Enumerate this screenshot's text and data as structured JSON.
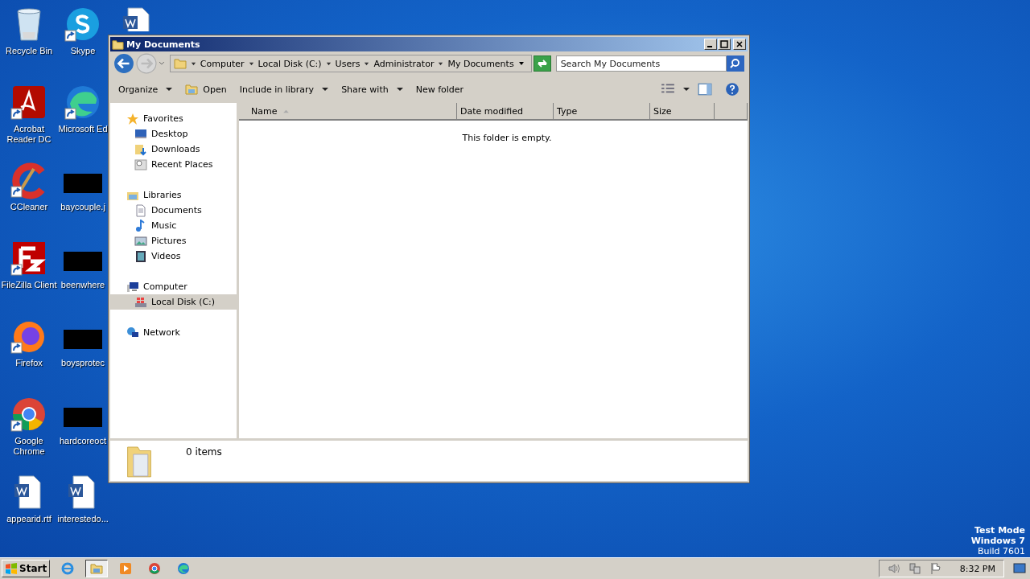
{
  "desktop_icons": [
    {
      "label": "Recycle Bin",
      "kind": "recycle",
      "shortcut": false
    },
    {
      "label": "Acrobat Reader DC",
      "kind": "acrobat",
      "shortcut": true
    },
    {
      "label": "CCleaner",
      "kind": "ccleaner",
      "shortcut": true
    },
    {
      "label": "FileZilla Client",
      "kind": "filezilla",
      "shortcut": true
    },
    {
      "label": "Firefox",
      "kind": "firefox",
      "shortcut": true
    },
    {
      "label": "Google Chrome",
      "kind": "chrome",
      "shortcut": true
    },
    {
      "label": "appearid.rtf",
      "kind": "word",
      "shortcut": false
    },
    {
      "label": "Skype",
      "kind": "skype",
      "shortcut": true
    },
    {
      "label": "Microsoft Ed",
      "kind": "edge",
      "shortcut": true
    },
    {
      "label": "baycouple.j",
      "kind": "thumb",
      "shortcut": false
    },
    {
      "label": "beenwhere",
      "kind": "thumb",
      "shortcut": false
    },
    {
      "label": "boysprotec",
      "kind": "thumb",
      "shortcut": false
    },
    {
      "label": "hardcoreoct",
      "kind": "thumb",
      "shortcut": false
    },
    {
      "label": "interestedo...",
      "kind": "word",
      "shortcut": false
    },
    {
      "kind": "word",
      "shortcut": false
    }
  ],
  "window": {
    "title": "My Documents",
    "address": [
      "Computer",
      "Local Disk (C:)",
      "Users",
      "Administrator",
      "My Documents"
    ],
    "search": {
      "placeholder": "Search My Documents"
    },
    "toolbar": [
      {
        "label": "Organize",
        "dropdown": true
      },
      {
        "label": "Open",
        "kind": "open",
        "dropdown": false
      },
      {
        "label": "Include in library",
        "dropdown": true
      },
      {
        "label": "Share with",
        "dropdown": true
      },
      {
        "label": "New folder",
        "dropdown": false
      }
    ],
    "nav": [
      {
        "label": "Favorites",
        "kind": "star",
        "selected": false,
        "children": [
          {
            "label": "Desktop",
            "kind": "desktop",
            "selected": false
          },
          {
            "label": "Downloads",
            "kind": "downloads",
            "selected": false
          },
          {
            "label": "Recent Places",
            "kind": "recent",
            "selected": false
          }
        ]
      },
      {
        "label": "Libraries",
        "kind": "library",
        "selected": false,
        "children": [
          {
            "label": "Documents",
            "kind": "document",
            "selected": false
          },
          {
            "label": "Music",
            "kind": "music",
            "selected": false
          },
          {
            "label": "Pictures",
            "kind": "pictures",
            "selected": false
          },
          {
            "label": "Videos",
            "kind": "videos",
            "selected": false
          }
        ]
      },
      {
        "label": "Computer",
        "kind": "computer",
        "selected": false,
        "children": [
          {
            "label": "Local Disk (C:)",
            "kind": "disk",
            "selected": true
          }
        ]
      },
      {
        "label": "Network",
        "kind": "network",
        "selected": false
      }
    ],
    "columns": [
      {
        "label": "Name",
        "sorted": true
      },
      {
        "label": "Date modified",
        "sorted": false
      },
      {
        "label": "Type",
        "sorted": false
      },
      {
        "label": "Size",
        "sorted": false
      }
    ],
    "empty_message": "This folder is empty.",
    "details": "0 items"
  },
  "desktop_notice": [
    "Test Mode",
    "Windows 7",
    "Build 7601"
  ],
  "taskbar": {
    "start": "Start",
    "apps": [
      {
        "kind": "ie",
        "selected": false
      },
      {
        "kind": "explorer",
        "selected": true
      },
      {
        "kind": "media",
        "selected": false
      },
      {
        "kind": "chrome",
        "selected": false
      },
      {
        "kind": "edge",
        "selected": false
      }
    ],
    "tray": [
      {
        "kind": "volume"
      },
      {
        "kind": "network"
      },
      {
        "kind": "flag"
      }
    ],
    "time": "8:32 PM"
  }
}
